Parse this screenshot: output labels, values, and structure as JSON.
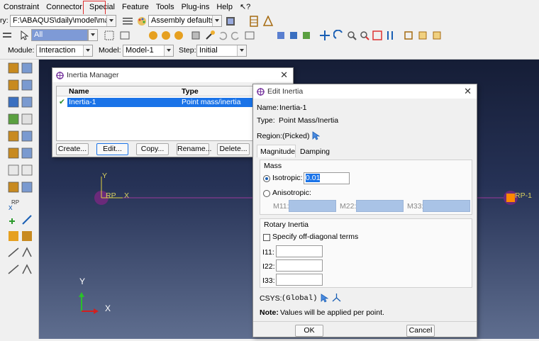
{
  "menubar": [
    "Constraint",
    "Connector",
    "Special",
    "Feature",
    "Tools",
    "Plug-ins",
    "Help",
    "↖?"
  ],
  "toolbar1": {
    "path_label": "ry:",
    "path_value": "F:\\ABAQUS\\daily\\model\\mass_t",
    "render_style": "Assembly defaults"
  },
  "toolbar2": {
    "selection_filter": "All"
  },
  "context": {
    "module_label": "Module:",
    "module_value": "Interaction",
    "model_label": "Model:",
    "model_value": "Model-1",
    "step_label": "Step:",
    "step_value": "Initial"
  },
  "inertia_manager": {
    "title": "Inertia Manager",
    "col_name": "Name",
    "col_type": "Type",
    "rows": [
      {
        "check": "✔",
        "name": "Inertia-1",
        "type": "Point mass/inertia"
      }
    ],
    "buttons": {
      "create": "Create...",
      "edit": "Edit...",
      "copy": "Copy...",
      "rename": "Rename...",
      "delete": "Delete..."
    }
  },
  "edit_inertia": {
    "title": "Edit Inertia",
    "name_label": "Name:",
    "name_value": "Inertia-1",
    "type_label": "Type:",
    "type_value": "Point Mass/Inertia",
    "region_label": "Region:",
    "region_value": "(Picked)",
    "tabs": [
      "Magnitude",
      "Damping"
    ],
    "mass_group": "Mass",
    "isotropic_label": "Isotropic:",
    "isotropic_value": "0.01",
    "anisotropic_label": "Anisotropic:",
    "m11": "M11:",
    "m22": "M22:",
    "m33": "M33:",
    "rotary_group": "Rotary Inertia",
    "offdiag_label": "Specify off-diagonal terms",
    "i11": "I11:",
    "i22": "I22:",
    "i33": "I33:",
    "csys_label": "CSYS:",
    "csys_value": "(Global)",
    "note_bold": "Note:",
    "note_text": "Values will be applied per point.",
    "ok": "OK",
    "cancel": "Cancel"
  },
  "viewport": {
    "rp_left": "RP",
    "x_axis": "X",
    "y_axis": "Y",
    "rp_right": "RP-1",
    "triad_x": "X",
    "triad_y": "Y"
  },
  "colors": {
    "accent": "#1a5fb4",
    "highlight": "#e03030",
    "rp_marker": "#ff8800"
  }
}
